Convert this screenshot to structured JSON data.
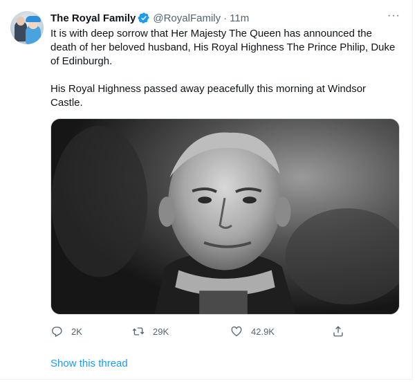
{
  "tweet": {
    "author_name": "The Royal Family",
    "handle": "@RoyalFamily",
    "separator": "·",
    "time": "11m",
    "more_glyph": "···",
    "paragraphs": [
      "It is with deep sorrow that Her Majesty The Queen has announced the death of her beloved husband, His Royal Highness The Prince Philip, Duke of Edinburgh.",
      "His Royal Highness passed away peacefully this morning at Windsor Castle."
    ],
    "verified": true,
    "verified_color": "#1d9bf0"
  },
  "actions": {
    "reply_count": "2K",
    "retweet_count": "29K",
    "like_count": "42.9K"
  },
  "thread_link": "Show this thread",
  "colors": {
    "link": "#1d9bf0",
    "secondary_text": "#536471",
    "primary_text": "#0f1419"
  }
}
